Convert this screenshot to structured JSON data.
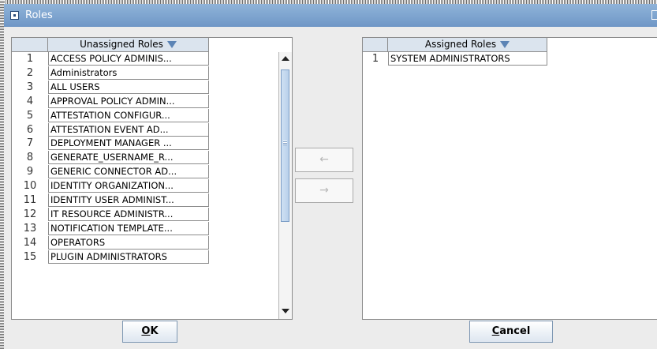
{
  "window": {
    "title": "Roles"
  },
  "unassigned": {
    "header": "Unassigned Roles",
    "rows": [
      {
        "num": "1",
        "name": "ACCESS POLICY ADMINIS..."
      },
      {
        "num": "2",
        "name": "Administrators"
      },
      {
        "num": "3",
        "name": "ALL USERS"
      },
      {
        "num": "4",
        "name": "APPROVAL POLICY ADMIN..."
      },
      {
        "num": "5",
        "name": "ATTESTATION CONFIGUR..."
      },
      {
        "num": "6",
        "name": "ATTESTATION EVENT AD..."
      },
      {
        "num": "7",
        "name": "DEPLOYMENT MANAGER ..."
      },
      {
        "num": "8",
        "name": "GENERATE_USERNAME_R..."
      },
      {
        "num": "9",
        "name": "GENERIC CONNECTOR AD..."
      },
      {
        "num": "10",
        "name": "IDENTITY ORGANIZATION..."
      },
      {
        "num": "11",
        "name": "IDENTITY USER ADMINIST..."
      },
      {
        "num": "12",
        "name": "IT RESOURCE ADMINISTR..."
      },
      {
        "num": "13",
        "name": "NOTIFICATION TEMPLATE..."
      },
      {
        "num": "14",
        "name": "OPERATORS"
      },
      {
        "num": "15",
        "name": "PLUGIN ADMINISTRATORS"
      }
    ]
  },
  "assigned": {
    "header": "Assigned Roles",
    "rows": [
      {
        "num": "1",
        "name": "SYSTEM ADMINISTRATORS"
      }
    ]
  },
  "buttons": {
    "move_left": "←",
    "move_right": "→",
    "ok": "OK",
    "cancel": "Cancel"
  },
  "colors": {
    "titlebar": "#7ea5d0",
    "header_bg": "#dbe4ee",
    "sort_arrow": "#5c84b5",
    "scroll_thumb": "#c4d9f0"
  }
}
